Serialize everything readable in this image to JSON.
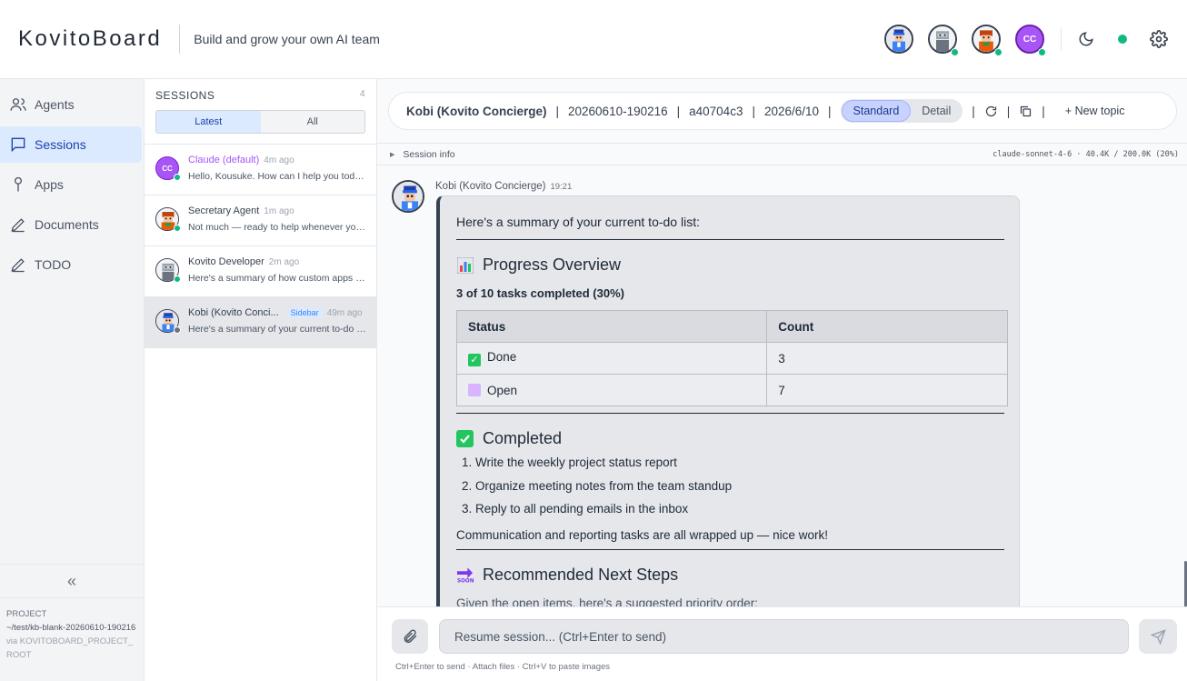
{
  "header": {
    "brand": "KovitoBoard",
    "tagline": "Build and grow your own AI team",
    "agents": [
      {
        "name": "kobi-avatar",
        "online": false
      },
      {
        "name": "developer-avatar",
        "online": true
      },
      {
        "name": "secretary-avatar",
        "online": true
      },
      {
        "name": "claude-avatar",
        "initials": "CC",
        "online": true
      }
    ]
  },
  "nav": {
    "items": [
      {
        "label": "Agents",
        "icon": "users-icon"
      },
      {
        "label": "Sessions",
        "icon": "chat-icon",
        "active": true
      },
      {
        "label": "Apps",
        "icon": "pin-icon"
      },
      {
        "label": "Documents",
        "icon": "pencil-icon"
      },
      {
        "label": "TODO",
        "icon": "pencil-icon"
      }
    ],
    "collapse": "«",
    "project_label": "PROJECT",
    "project_path": "~/test/kb-blank-20260610-190216",
    "project_via": "via KOVITOBOARD_PROJECT_ROOT"
  },
  "sessions": {
    "title": "SESSIONS",
    "count": "4",
    "tabs": {
      "latest": "Latest",
      "all": "All"
    },
    "items": [
      {
        "name": "Claude (default)",
        "time": "4m ago",
        "preview": "Hello, Kousuke. How can I help you today?",
        "initials": "CC"
      },
      {
        "name": "Secretary Agent",
        "time": "1m ago",
        "preview": "Not much — ready to help whenever you need."
      },
      {
        "name": "Kovito Developer",
        "time": "2m ago",
        "preview": "Here's a summary of how custom apps work."
      },
      {
        "name": "Kobi (Kovito Conci...",
        "badge": "Sidebar",
        "time": "49m ago",
        "preview": "Here's a summary of your current to-do list"
      }
    ]
  },
  "topic": {
    "agent": "Kobi (Kovito Concierge)",
    "session_id": "20260610-190216",
    "commit": "a40704c3",
    "date": "2026/6/10",
    "view_standard": "Standard",
    "view_detail": "Detail",
    "new_topic": "New topic",
    "sep": "|"
  },
  "session_info": {
    "label": "Session info",
    "model": "claude-sonnet-4-6 · 40.4K / 200.0K (20%)"
  },
  "message": {
    "author": "Kobi (Kovito Concierge)",
    "time": "19:21",
    "intro": "Here's a summary of your current to-do list:",
    "progress_heading": "Progress Overview",
    "progress_summary": "3 of 10 tasks completed (30%)",
    "table_headers": [
      "Status",
      "Count"
    ],
    "table_rows": [
      {
        "status": "Done",
        "count": "3"
      },
      {
        "status": "Open",
        "count": "7"
      }
    ],
    "completed_heading": "Completed",
    "completed_items": [
      "Write the weekly project status report",
      "Organize meeting notes from the team standup",
      "Reply to all pending emails in the inbox"
    ],
    "completed_note": "Communication and reporting tasks are all wrapped up — nice work!",
    "next_heading": "Recommended Next Steps",
    "next_intro": "Given the open items, here's a suggested priority order:"
  },
  "composer": {
    "placeholder": "Resume session... (Ctrl+Enter to send)",
    "hint": "Ctrl+Enter to send · Attach files · Ctrl+V to paste images"
  },
  "colors": {
    "accent": "#1e40af",
    "online": "#10b981",
    "claude": "#a855f7"
  }
}
